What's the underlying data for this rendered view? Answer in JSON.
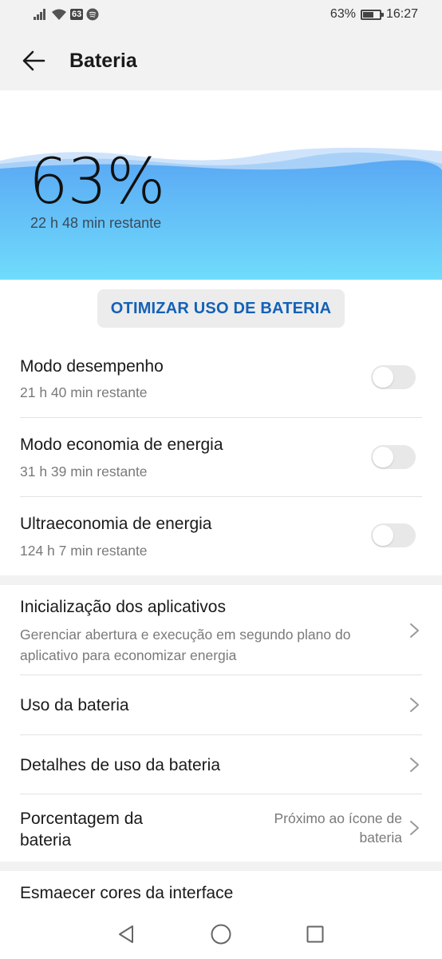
{
  "status_bar": {
    "sim_badge": "63",
    "battery_percent": "63%",
    "battery_level": 0.63,
    "time": "16:27",
    "icons": [
      "signal-icon",
      "wifi-icon",
      "spotify-icon",
      "battery-icon"
    ]
  },
  "header": {
    "title": "Bateria"
  },
  "hero": {
    "percent": "63%",
    "remaining": "22 h 48 min restante"
  },
  "optimize_label": "OTIMIZAR USO DE BATERIA",
  "modes": [
    {
      "title": "Modo desempenho",
      "subtitle": "21 h 40 min restante",
      "enabled": false
    },
    {
      "title": "Modo economia de energia",
      "subtitle": "31 h 39 min restante",
      "enabled": false
    },
    {
      "title": "Ultraeconomia de energia",
      "subtitle": "124 h 7 min restante",
      "enabled": false
    }
  ],
  "settings": {
    "app_launch": {
      "title": "Inicialização dos aplicativos",
      "subtitle_line1": "Gerenciar abertura e execução em segundo plano do",
      "subtitle_line2": "aplicativo para economizar energia"
    },
    "battery_usage": {
      "title": "Uso da bateria"
    },
    "usage_details": {
      "title": "Detalhes de uso da bateria"
    },
    "percentage": {
      "title_line1": "Porcentagem da",
      "title_line2": "bateria",
      "value_line1": "Próximo ao ícone de",
      "value_line2": "bateria"
    },
    "dim_colors": {
      "title": "Esmaecer cores da interface"
    }
  },
  "colors": {
    "accent": "#1361b8",
    "wave_top": "#5aabf5",
    "wave_bottom": "#6dd8fa"
  }
}
